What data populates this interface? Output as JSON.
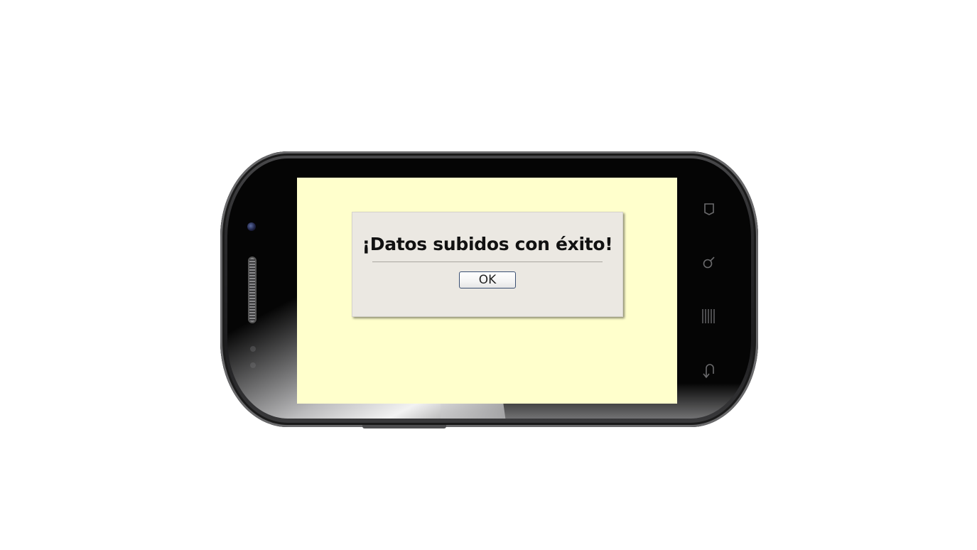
{
  "dialog": {
    "message": "¡Datos subidos con éxito!",
    "ok_label": "OK"
  },
  "colors": {
    "screen_background": "#ffffcc",
    "dialog_background": "#ebe8e2"
  },
  "device": {
    "soft_keys": [
      "home-icon",
      "search-icon",
      "menu-icon",
      "back-icon"
    ]
  }
}
